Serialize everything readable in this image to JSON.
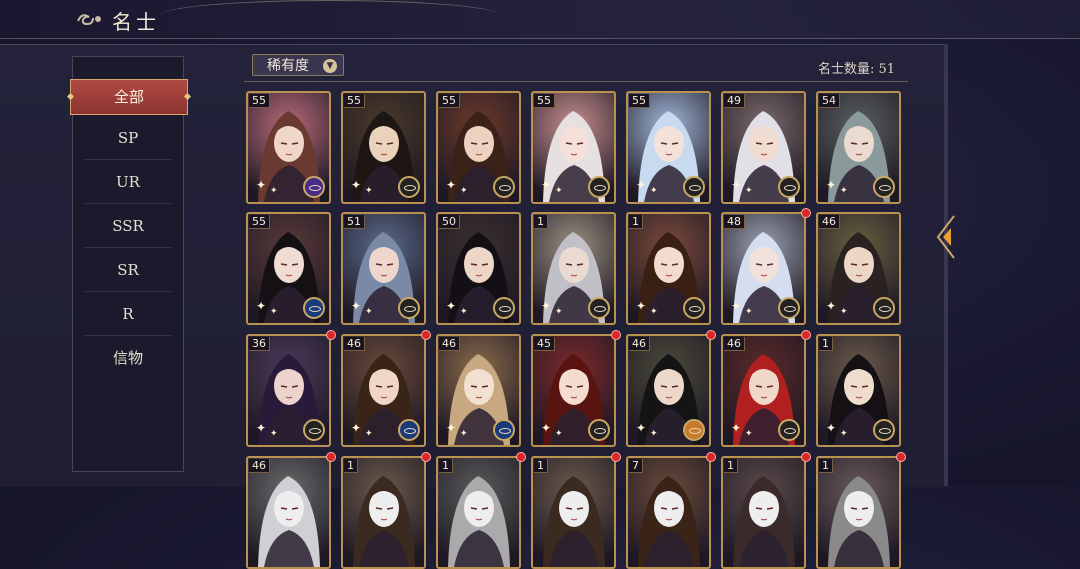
{
  "header": {
    "title": "名士"
  },
  "sidebar": {
    "items": [
      {
        "label": "全部",
        "active": true
      },
      {
        "label": "SP"
      },
      {
        "label": "UR"
      },
      {
        "label": "SSR"
      },
      {
        "label": "SR"
      },
      {
        "label": "R"
      },
      {
        "label": "信物"
      }
    ]
  },
  "filter": {
    "label": "稀有度"
  },
  "count": {
    "label": "名士数量:",
    "value": "51"
  },
  "colors": {
    "accent_red": "#a8403a",
    "gold_frame": "#b8924e",
    "notify_dot": "#d8282a"
  },
  "cards": [
    {
      "level": "55",
      "bg": "#b86a7a",
      "hair": "#6a3a30",
      "skin": "#f0d6c8",
      "badge": "purple",
      "dot": false
    },
    {
      "level": "55",
      "bg": "#4a3a2a",
      "hair": "#1e1612",
      "skin": "#ead2bc",
      "badge": "dark",
      "dot": false
    },
    {
      "level": "55",
      "bg": "#6a3a2a",
      "hair": "#3a2218",
      "skin": "#ecd2bf",
      "badge": "dark",
      "dot": false
    },
    {
      "level": "55",
      "bg": "#c89090",
      "hair": "#e6e0e0",
      "skin": "#f4e0d8",
      "badge": "dark",
      "dot": false
    },
    {
      "level": "55",
      "bg": "#a0b8d8",
      "hair": "#c8daf0",
      "skin": "#f2e2da",
      "badge": "dark",
      "dot": false
    },
    {
      "level": "49",
      "bg": "#7a6a6a",
      "hair": "#e0e0e6",
      "skin": "#f0dcd0",
      "badge": "dark",
      "dot": false
    },
    {
      "level": "54",
      "bg": "#5a6060",
      "hair": "#8a9a9a",
      "skin": "#eadad0",
      "badge": "dark",
      "dot": false
    },
    {
      "level": "55",
      "bg": "#5a3a3a",
      "hair": "#141014",
      "skin": "#f0dcd2",
      "badge": "blue",
      "dot": false
    },
    {
      "level": "51",
      "bg": "#5a6a8a",
      "hair": "#7a8aa6",
      "skin": "#eed6cc",
      "badge": "dark",
      "dot": false
    },
    {
      "level": "50",
      "bg": "#3a3030",
      "hair": "#121014",
      "skin": "#ecd6c8",
      "badge": "dark",
      "dot": false
    },
    {
      "level": "1",
      "bg": "#9a9080",
      "hair": "#c0c0c6",
      "skin": "#eadad0",
      "badge": "dark",
      "dot": false
    },
    {
      "level": "1",
      "bg": "#7a4a3a",
      "hair": "#3a2014",
      "skin": "#f2dcd0",
      "badge": "dark",
      "dot": false
    },
    {
      "level": "48",
      "bg": "#9aa0b0",
      "hair": "#d4def0",
      "skin": "#f0e2da",
      "badge": "dark",
      "dot": true
    },
    {
      "level": "46",
      "bg": "#6a6040",
      "hair": "#2a2220",
      "skin": "#ecd6c6",
      "badge": "dark",
      "dot": false
    },
    {
      "level": "36",
      "bg": "#4a3a5a",
      "hair": "#2a1a3a",
      "skin": "#ecd4cc",
      "badge": "dark",
      "dot": true
    },
    {
      "level": "46",
      "bg": "#6a4a3a",
      "hair": "#3a2418",
      "skin": "#f0d6c4",
      "badge": "blue",
      "dot": true
    },
    {
      "level": "46",
      "bg": "#8a6a4a",
      "hair": "#c8a880",
      "skin": "#f2e0d0",
      "badge": "blue",
      "dot": false
    },
    {
      "level": "45",
      "bg": "#7a2a2a",
      "hair": "#5a1410",
      "skin": "#f4dcd0",
      "badge": "dark",
      "dot": true
    },
    {
      "level": "46",
      "bg": "#4a4a3a",
      "hair": "#141414",
      "skin": "#ecd8ca",
      "badge": "orange",
      "dot": true
    },
    {
      "level": "46",
      "bg": "#5a2a2a",
      "hair": "#b02020",
      "skin": "#f0d8c8",
      "badge": "dark",
      "dot": true
    },
    {
      "level": "1",
      "bg": "#6a5a4a",
      "hair": "#141014",
      "skin": "#f0dccc",
      "badge": "dark",
      "dot": false
    },
    {
      "level": "46",
      "bg": "#6a6a6a",
      "hair": "#cfcfd4",
      "skin": "#eee",
      "badge": "none",
      "dot": true
    },
    {
      "level": "1",
      "bg": "#6a5a4a",
      "hair": "#3a2a20",
      "skin": "#eee",
      "badge": "none",
      "dot": true
    },
    {
      "level": "1",
      "bg": "#5a5a5a",
      "hair": "#aaa",
      "skin": "#eee",
      "badge": "none",
      "dot": true
    },
    {
      "level": "1",
      "bg": "#6a5a4a",
      "hair": "#3a2a20",
      "skin": "#eee",
      "badge": "none",
      "dot": true
    },
    {
      "level": "7",
      "bg": "#6a4a3a",
      "hair": "#3a2418",
      "skin": "#eee",
      "badge": "none",
      "dot": true
    },
    {
      "level": "1",
      "bg": "#5a4a4a",
      "hair": "#3a2a2a",
      "skin": "#eee",
      "badge": "none",
      "dot": true
    },
    {
      "level": "1",
      "bg": "#6a5a5a",
      "hair": "#8a8a8a",
      "skin": "#eee",
      "badge": "none",
      "dot": true
    }
  ]
}
